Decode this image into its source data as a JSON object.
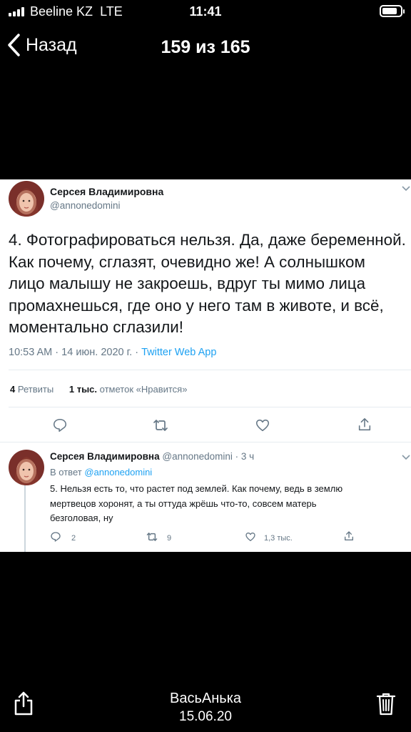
{
  "status_bar": {
    "carrier": "Beeline KZ",
    "network": "LTE",
    "time": "11:41",
    "signal_bars": 4,
    "battery_level": 0.85
  },
  "nav": {
    "back_label": "Назад",
    "counter": "159 из 165",
    "back_icon": "chevron-left-icon"
  },
  "tweet": {
    "author_name": "Серсея Владимировна",
    "author_handle": "@annonedomini",
    "lines": [
      "4. Фотографироваться нельзя. Да, даже беременной.",
      "Как почему, сглазят, очевидно же! А солнышком",
      "лицо малышу не закроешь, вдруг ты мимо лица",
      "промахнешься, где оно у него там в животе, и всё,",
      "моментально сглазили!"
    ],
    "time": "10:53 AM",
    "date": "14 июн. 2020 г.",
    "source": "Twitter Web App",
    "retweets_count": "4",
    "retweets_label": "Ретвиты",
    "likes_count": "1 тыс.",
    "likes_label": "отметок «Нравится»"
  },
  "reply": {
    "author_name": "Серсея Владимировна",
    "author_handle": "@annonedomini",
    "age": "3 ч",
    "reply_prefix": "В ответ",
    "reply_to": "@annonedomini",
    "lines": [
      "5. Нельзя есть то, что растет под землей. Как почему, ведь в землю",
      "мертвецов хоронят, а ты оттуда жрёшь что-то, совсем матерь",
      "безголовая, ну"
    ],
    "replies_count": "2",
    "retweets_count": "9",
    "likes_count": "1,3 тыс."
  },
  "bottom": {
    "sender": "ВасьАнька",
    "date": "15.06.20",
    "share_icon": "share-icon",
    "trash_icon": "trash-icon"
  },
  "colors": {
    "background": "#000000",
    "tweet_background": "#ffffff",
    "text_primary": "#14171a",
    "text_secondary": "#657786",
    "link": "#1da1f2"
  }
}
